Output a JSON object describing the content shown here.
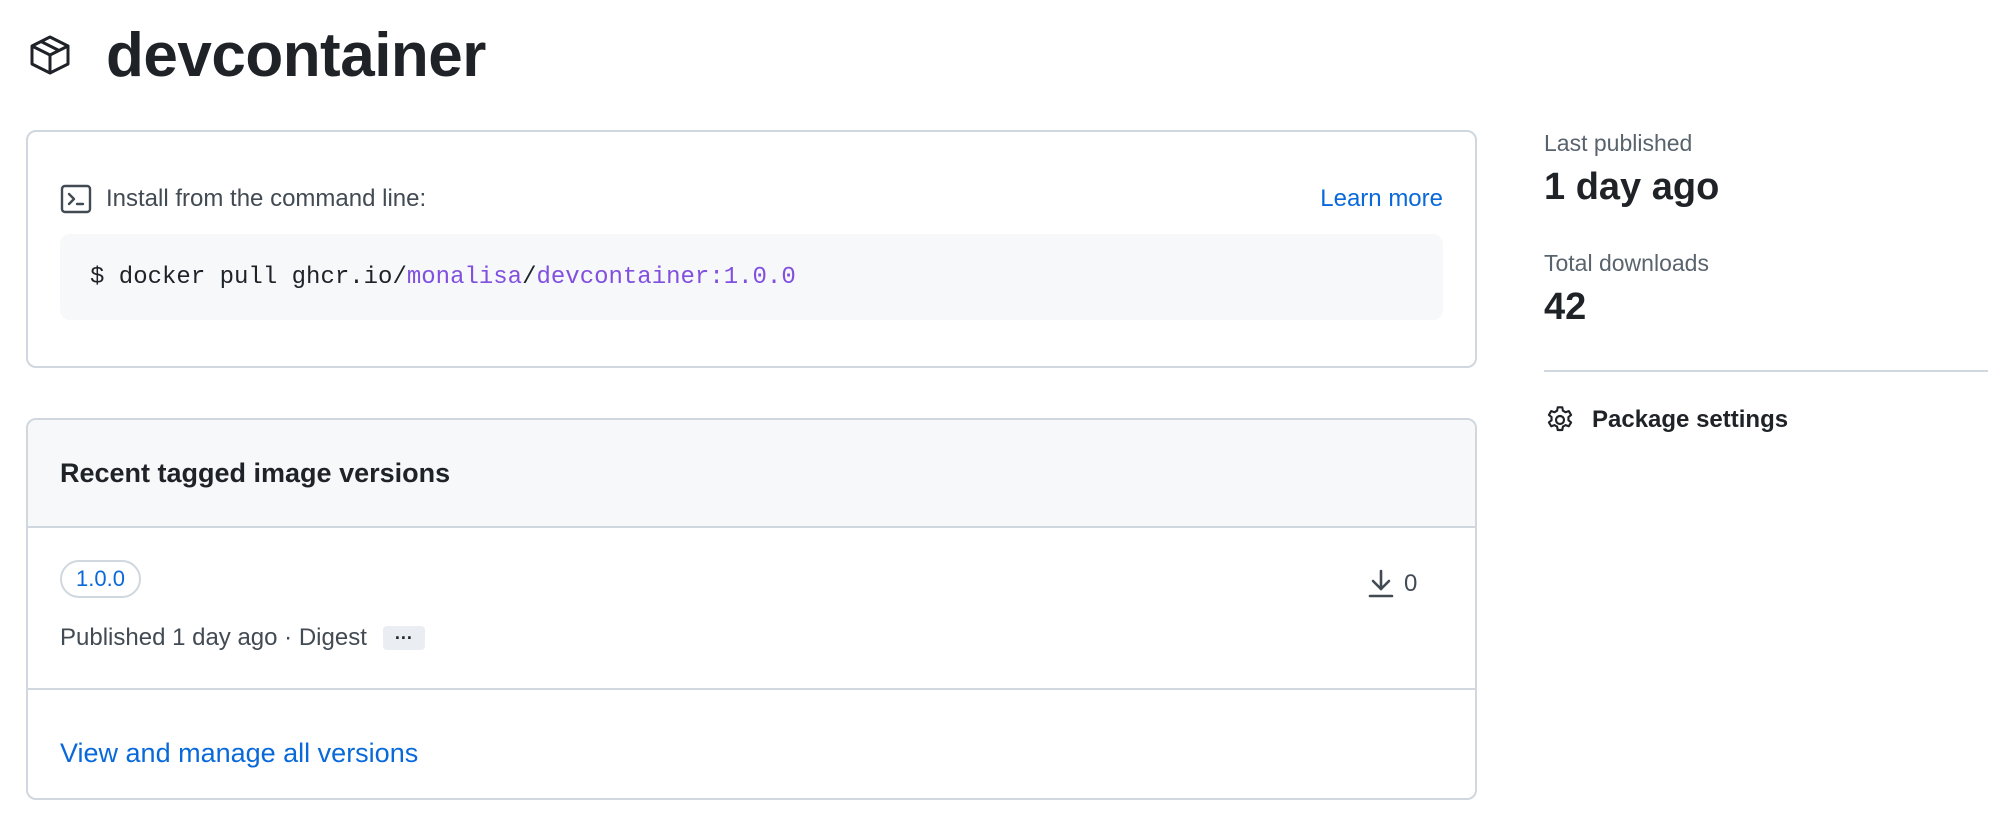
{
  "package": {
    "name": "devcontainer",
    "icon": "package-icon"
  },
  "install": {
    "label": "Install from the command line:",
    "learn_more": "Learn more",
    "icon": "terminal-icon",
    "command": {
      "prefix": "$ docker pull ghcr.io/",
      "owner": "monalisa",
      "sep": "/",
      "image": "devcontainer:1.0.0"
    }
  },
  "versions": {
    "heading": "Recent tagged image versions",
    "items": [
      {
        "tag": "1.0.0",
        "meta": "Published 1 day ago · Digest",
        "ellipsis": "···",
        "downloads": "0"
      }
    ],
    "view_all": "View and manage all versions"
  },
  "sidebar": {
    "last_published_label": "Last published",
    "last_published_value": "1 day ago",
    "total_downloads_label": "Total downloads",
    "total_downloads_value": "42",
    "settings_label": "Package settings"
  },
  "colors": {
    "link": "#0969da",
    "purple": "#8250df",
    "border": "#d0d7de",
    "muted_bg": "#f6f8fa"
  }
}
